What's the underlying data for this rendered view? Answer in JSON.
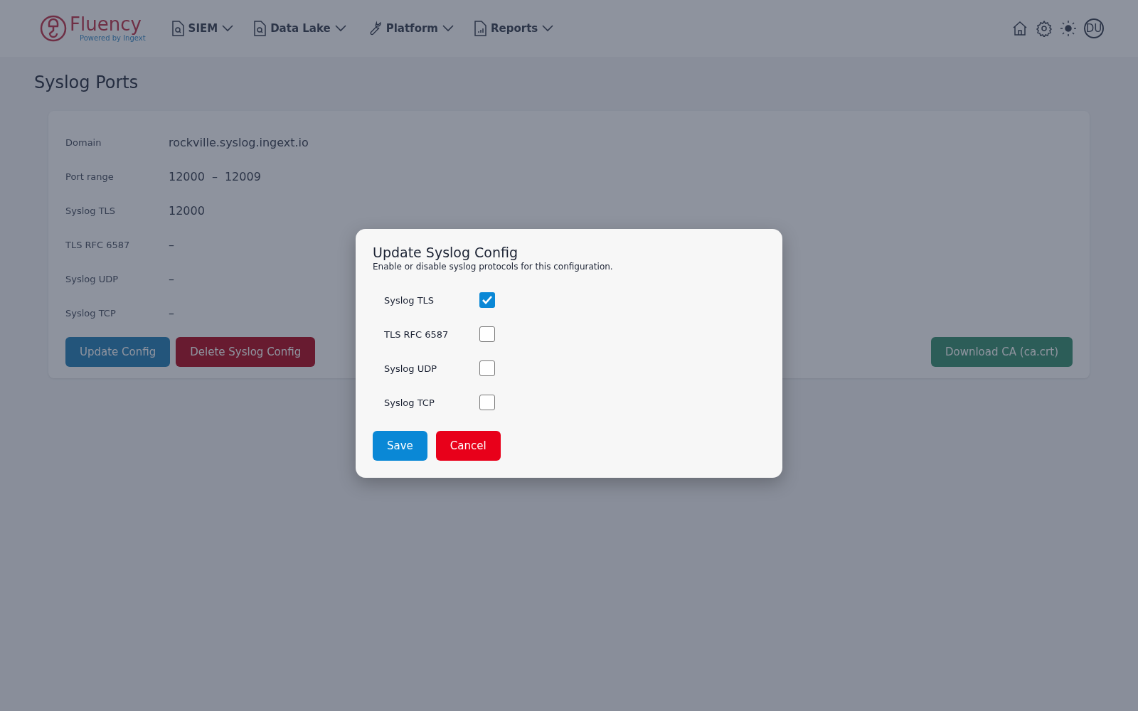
{
  "brand": {
    "name": "Fluency",
    "tagline": "Powered by Ingext"
  },
  "nav": [
    {
      "label": "SIEM"
    },
    {
      "label": "Data Lake"
    },
    {
      "label": "Platform"
    },
    {
      "label": "Reports"
    }
  ],
  "user": {
    "initials": "DU"
  },
  "page": {
    "title": "Syslog Ports"
  },
  "fields": [
    {
      "label": "Domain",
      "value_parts": [
        "rockville.syslog.ingext.io"
      ]
    },
    {
      "label": "Port range",
      "value_parts": [
        "12000",
        "–",
        "12009"
      ]
    },
    {
      "label": "Syslog TLS",
      "value_parts": [
        "12000"
      ]
    },
    {
      "label": "TLS RFC 6587",
      "value_parts": [
        "–"
      ]
    },
    {
      "label": "Syslog UDP",
      "value_parts": [
        "–"
      ]
    },
    {
      "label": "Syslog TCP",
      "value_parts": [
        "–"
      ]
    }
  ],
  "actions": [
    {
      "label": "Update Config",
      "kind": "primary"
    },
    {
      "label": "Delete Syslog Config",
      "kind": "danger"
    }
  ],
  "download": {
    "label": "Download CA (ca.crt)"
  },
  "dialog": {
    "title": "Update Syslog Config",
    "description": "Enable or disable syslog protocols for this configuration.",
    "options": [
      {
        "label": "Syslog TLS",
        "checked": true
      },
      {
        "label": "TLS RFC 6587",
        "checked": false
      },
      {
        "label": "Syslog UDP",
        "checked": false
      },
      {
        "label": "Syslog TCP",
        "checked": false
      }
    ],
    "buttons": [
      {
        "label": "Save",
        "kind": "primary"
      },
      {
        "label": "Cancel",
        "kind": "danger"
      }
    ]
  }
}
